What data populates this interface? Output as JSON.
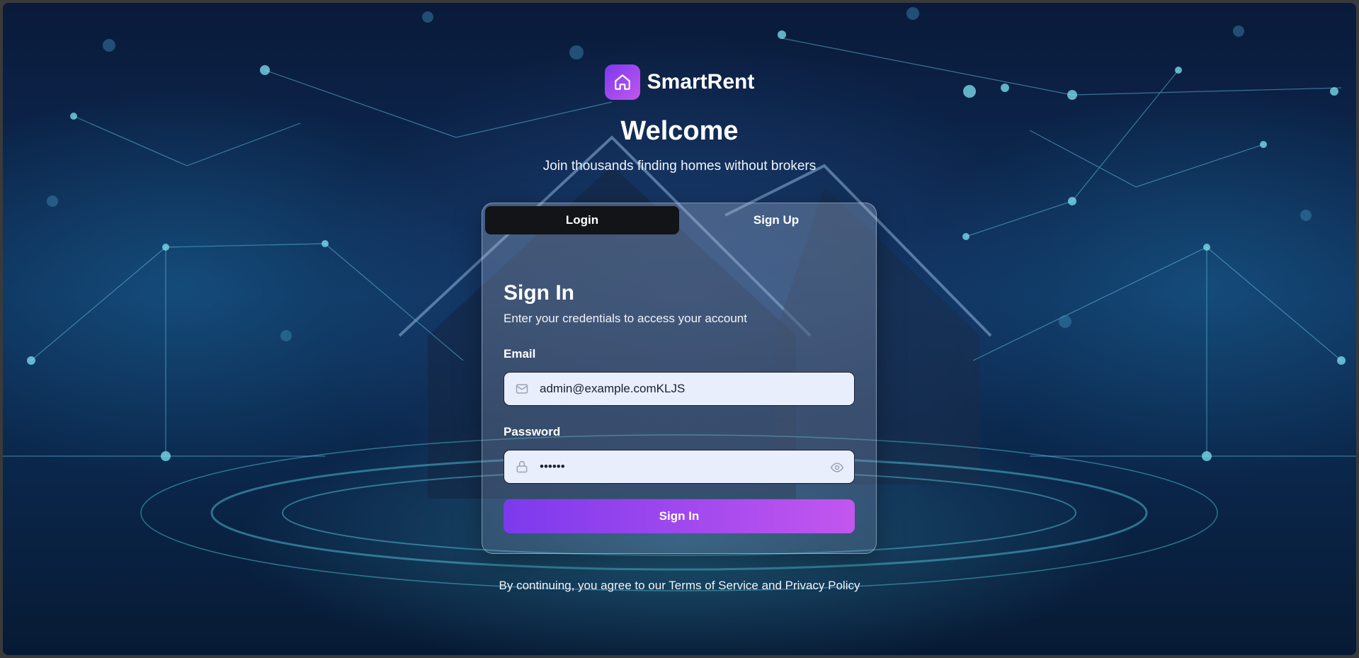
{
  "brand": {
    "name": "SmartRent"
  },
  "hero": {
    "title": "Welcome",
    "subtitle": "Join thousands finding homes without brokers"
  },
  "tabs": [
    {
      "label": "Login",
      "active": true
    },
    {
      "label": "Sign Up",
      "active": false
    }
  ],
  "form": {
    "title": "Sign In",
    "subtitle": "Enter your credentials to access your account",
    "email": {
      "label": "Email",
      "value": "admin@example.comKLJS",
      "icon": "mail-icon"
    },
    "password": {
      "label": "Password",
      "value": "••••••",
      "icon": "lock-icon",
      "toggle_icon": "eye-icon"
    },
    "submit_label": "Sign In"
  },
  "footer": {
    "text": "By continuing, you agree to our Terms of Service and Privacy Policy"
  },
  "colors": {
    "accent_start": "#7c3aed",
    "accent_end": "#c356ee",
    "active_tab": "#121418",
    "input_bg": "#e8eefc"
  }
}
